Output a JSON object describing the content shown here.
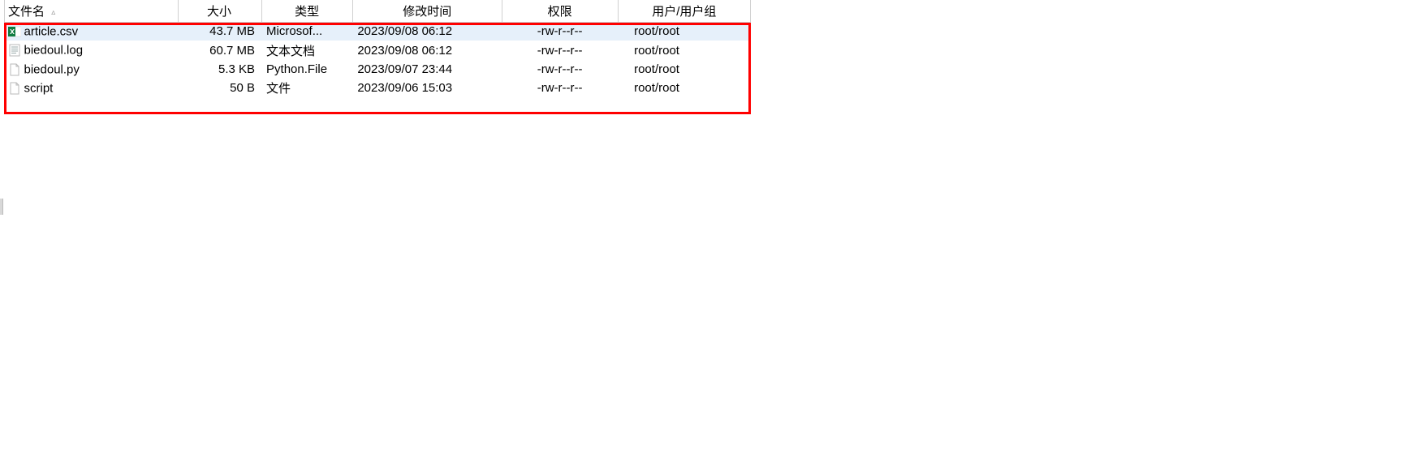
{
  "columns": {
    "name": "文件名",
    "size": "大小",
    "type": "类型",
    "modified": "修改时间",
    "permissions": "权限",
    "owner": "用户/用户组"
  },
  "sort_glyph": "▵",
  "files": [
    {
      "icon": "excel-icon",
      "name": "article.csv",
      "size": "43.7 MB",
      "type": "Microsof...",
      "modified": "2023/09/08 06:12",
      "permissions": "-rw-r--r--",
      "owner": "root/root",
      "selected": true
    },
    {
      "icon": "text-icon",
      "name": "biedoul.log",
      "size": "60.7 MB",
      "type": "文本文档",
      "modified": "2023/09/08 06:12",
      "permissions": "-rw-r--r--",
      "owner": "root/root",
      "selected": false
    },
    {
      "icon": "file-icon",
      "name": "biedoul.py",
      "size": "5.3 KB",
      "type": "Python.File",
      "modified": "2023/09/07 23:44",
      "permissions": "-rw-r--r--",
      "owner": "root/root",
      "selected": false
    },
    {
      "icon": "file-icon",
      "name": "script",
      "size": "50 B",
      "type": "文件",
      "modified": "2023/09/06 15:03",
      "permissions": "-rw-r--r--",
      "owner": "root/root",
      "selected": false
    }
  ]
}
